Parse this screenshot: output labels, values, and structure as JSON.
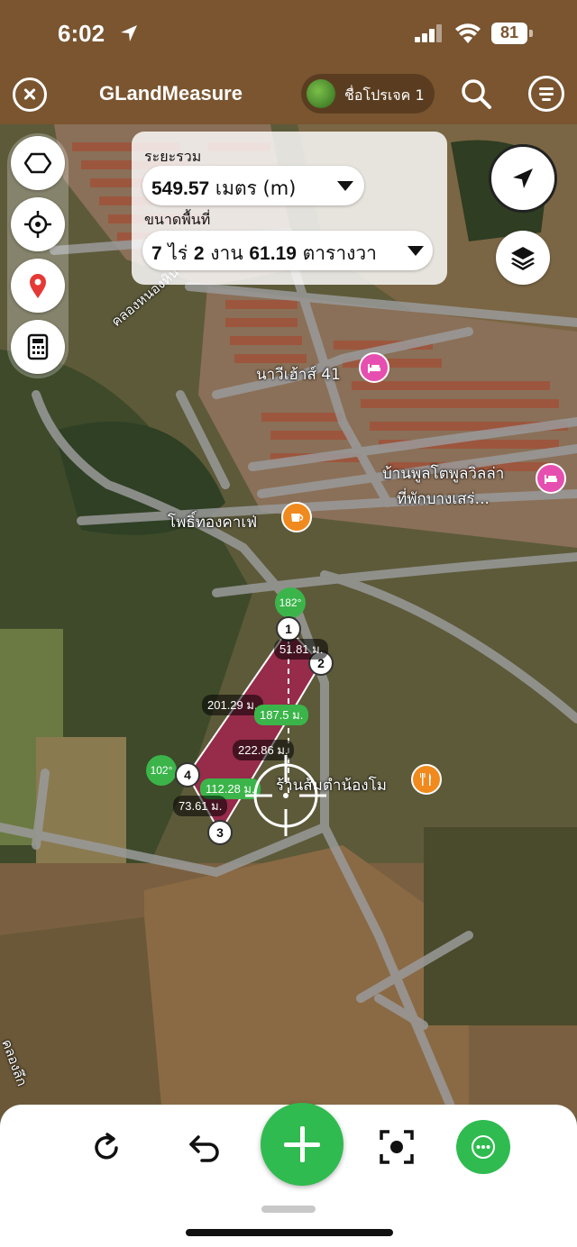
{
  "status_bar": {
    "time": "6:02",
    "battery": "81"
  },
  "header": {
    "title": "GLandMeasure",
    "project_name": "ชื่อโปรเจค 1"
  },
  "info_panel": {
    "distance_label": "ระยะรวม",
    "distance_value": "549.57",
    "distance_unit": "เมตร (m)",
    "area_label": "ขนาดพื้นที่",
    "area_rai": "7",
    "area_rai_unit": "ไร่",
    "area_ngan": "2",
    "area_ngan_unit": "งาน",
    "area_wa": "61.19",
    "area_wa_unit": "ตารางวา"
  },
  "map_labels": {
    "canal1": "คลองหนองหิน",
    "canal2": "คลองลึก",
    "poi_hotel1": "นาวีเฮ้าส์ 41",
    "poi_hotel2_line1": "บ้านพูลโตพูลวิลล่า",
    "poi_hotel2_line2": "ที่พักบางเสร่...",
    "poi_cafe": "โพธิ์ทองคาเฟ่",
    "poi_restaurant": "ร้านส้มตำน้องโม"
  },
  "polygon": {
    "vertices": [
      "1",
      "2",
      "3",
      "4"
    ],
    "angles": [
      "182°",
      "102°"
    ],
    "edge_labels": [
      "51.81 ม.",
      "201.29 ม.",
      "187.5 ม.",
      "222.86 ม.",
      "112.28 ม.",
      "73.61 ม."
    ]
  },
  "colors": {
    "header": "#7a5530",
    "accent_green": "#2fbb4f",
    "polygon_fill": "#a0234d",
    "poi_pink": "#e64fb0",
    "poi_orange": "#f08a1e"
  },
  "icons": [
    "polygon-icon",
    "crosshair-icon",
    "pin-icon",
    "calculator-icon",
    "navigate-icon",
    "layers-icon",
    "refresh-icon",
    "undo-icon",
    "add-icon",
    "focus-icon",
    "more-icon",
    "search-icon",
    "menu-icon",
    "close-icon"
  ]
}
